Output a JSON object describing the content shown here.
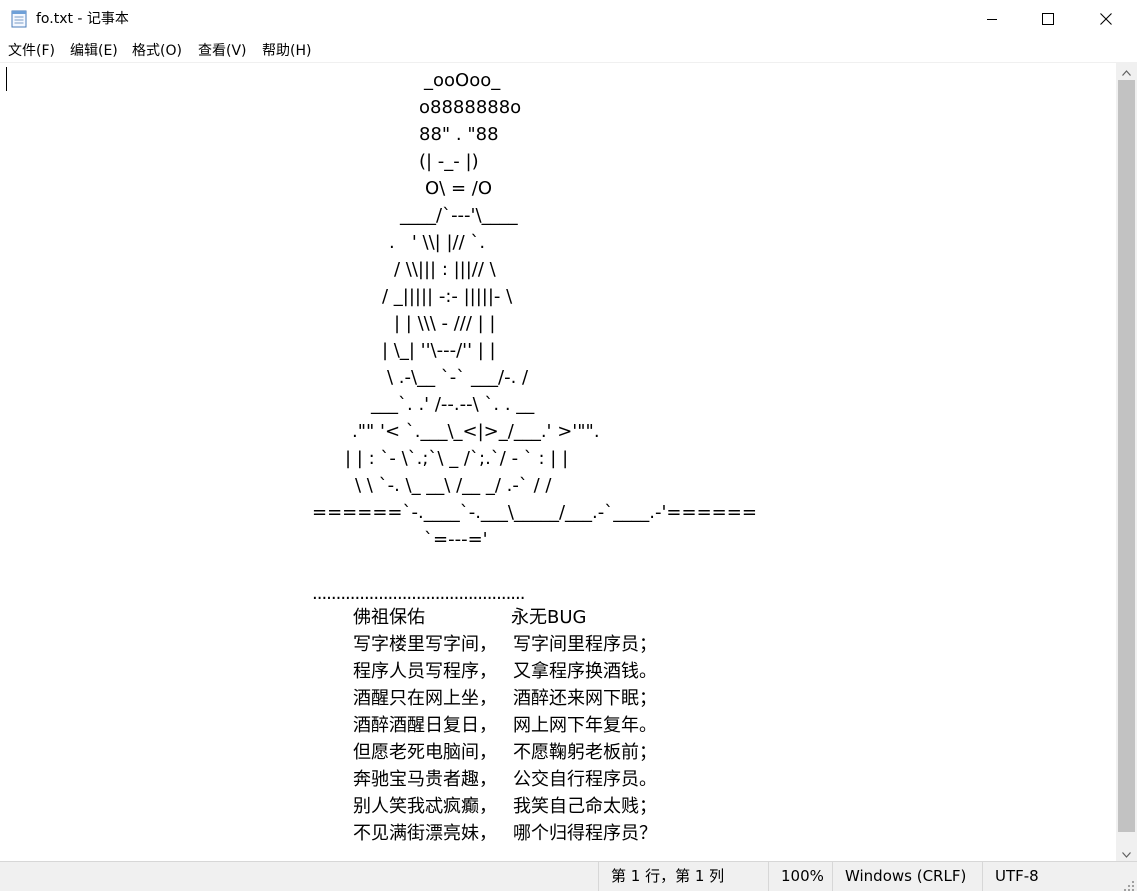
{
  "window": {
    "title": "fo.txt - 记事本",
    "icon": "notepad-icon",
    "controls": [
      "minimize-icon",
      "maximize-icon",
      "close-icon"
    ]
  },
  "menu": {
    "file": "文件(F)",
    "edit": "编辑(E)",
    "format": "格式(O)",
    "view": "查看(V)",
    "help": "帮助(H)"
  },
  "document": {
    "art": [
      "_ooOoo_",
      "o8888888o",
      "88\" . \"88",
      "(| -_- |)",
      "O\\ = /O",
      "____/`---'\\____",
      ".   ' \\\\| |// `.",
      "/ \\\\||| : |||// \\",
      "/ _||||| -:- |||||- \\",
      "| | \\\\\\ - /// | |",
      "| \\_| ''\\---/'' | |",
      "\\ .-\\__ `-` ___/-. /",
      "___`. .' /--.--\\ `. . __",
      ".\"\" '< `.___\\_<|>_/___.' >'\"\".",
      "| | : `- \\`.;`\\ _ /`;.`/ - ` : | |",
      "\\ \\ `-. \\_ __\\ /__ _/ .-` / /",
      "======`-.____`-.___\\_____/___.-`____.-'======",
      "`=---='"
    ],
    "dots": ".............................................",
    "poem": [
      [
        "佛祖保佑",
        "永无BUG"
      ],
      [
        "写字楼里写字间，",
        "写字间里程序员；"
      ],
      [
        "程序人员写程序，",
        "又拿程序换酒钱。"
      ],
      [
        "酒醒只在网上坐，",
        "酒醉还来网下眠；"
      ],
      [
        "酒醉酒醒日复日，",
        "网上网下年复年。"
      ],
      [
        "但愿老死电脑间，",
        "不愿鞠躬老板前；"
      ],
      [
        "奔驰宝马贵者趣，",
        "公交自行程序员。"
      ],
      [
        "别人笑我忒疯癫，",
        "我笑自己命太贱；"
      ],
      [
        "不见满街漂亮妹，",
        "哪个归得程序员？"
      ]
    ]
  },
  "status": {
    "position": "第 1 行，第 1 列",
    "zoom": "100%",
    "line_ending": "Windows (CRLF)",
    "encoding": "UTF-8"
  }
}
